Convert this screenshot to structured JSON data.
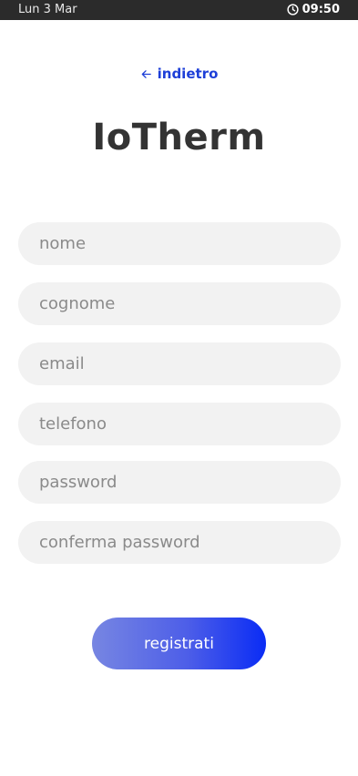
{
  "status_bar": {
    "date": "Lun 3 Mar",
    "time": "09:50"
  },
  "back": {
    "label": "indietro"
  },
  "app": {
    "title": "IoTherm"
  },
  "form": {
    "fields": [
      {
        "placeholder": "nome",
        "value": ""
      },
      {
        "placeholder": "cognome",
        "value": ""
      },
      {
        "placeholder": "email",
        "value": ""
      },
      {
        "placeholder": "telefono",
        "value": ""
      },
      {
        "placeholder": "password",
        "value": ""
      },
      {
        "placeholder": "conferma password",
        "value": ""
      }
    ],
    "submit_label": "registrati"
  },
  "colors": {
    "accent": "#1d3fd8",
    "button_gradient_start": "#7786e2",
    "button_gradient_end": "#0a2cf5",
    "field_bg": "#f2f2f2",
    "status_bar_bg": "#2b2b2b"
  },
  "icons": {
    "status_clock": "clock-icon",
    "back_arrow": "arrow-left-icon"
  }
}
